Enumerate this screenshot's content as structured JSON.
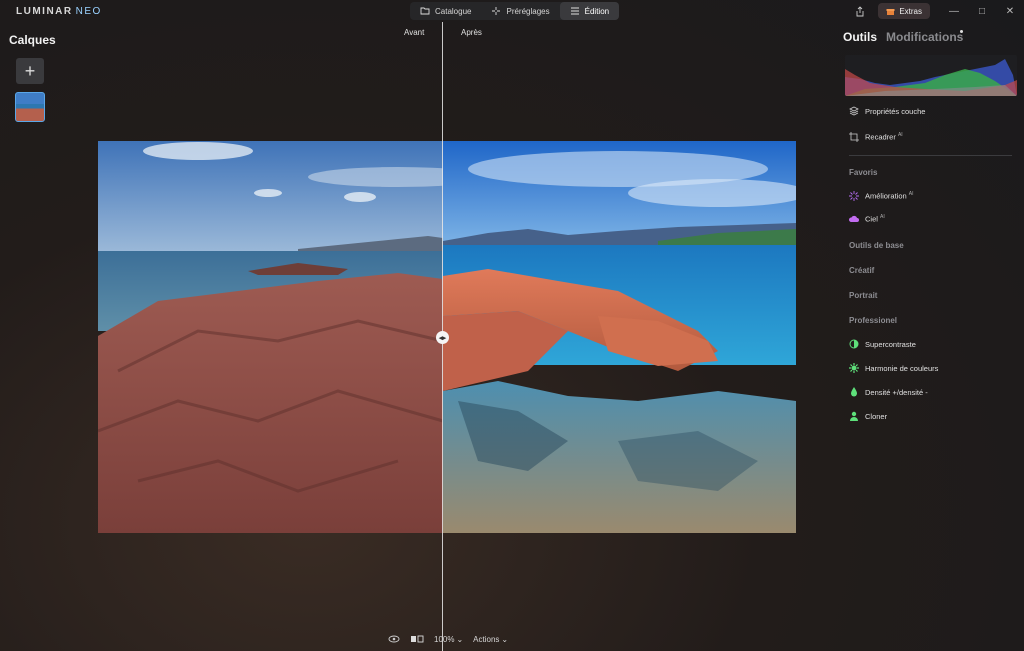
{
  "app": {
    "logo_main": "LUMINAR",
    "logo_sub": "NEO"
  },
  "modes": [
    {
      "label": "Catalogue",
      "icon": "folder-icon",
      "active": false
    },
    {
      "label": "Préréglages",
      "icon": "sparkle-icon",
      "active": false
    },
    {
      "label": "Édition",
      "icon": "sliders-icon",
      "active": true
    }
  ],
  "topright": {
    "extras_label": "Extras",
    "extras_color": "#e8823a"
  },
  "layers": {
    "title": "Calques",
    "add_label": "+"
  },
  "compare": {
    "before_label": "Avant",
    "after_label": "Après",
    "split_handle": "◂▸"
  },
  "bottom": {
    "zoom": "100%",
    "zoom_chevron": "⌄",
    "actions": "Actions",
    "actions_chevron": "⌄"
  },
  "right_panel": {
    "tabs": [
      {
        "label": "Outils",
        "active": true
      },
      {
        "label": "Modifications",
        "active": false
      }
    ],
    "top_tools": [
      {
        "label": "Propriétés couche",
        "icon": "layers-icon",
        "ai": ""
      },
      {
        "label": "Recadrer",
        "icon": "crop-icon",
        "ai": "AI"
      }
    ],
    "favorites_title": "Favoris",
    "favorites": [
      {
        "label": "Amélioration",
        "icon": "sparkle-icon",
        "ai": "AI",
        "color": "#b36cf0"
      },
      {
        "label": "Ciel",
        "icon": "cloud-icon",
        "ai": "AI",
        "color": "#c26cf0"
      }
    ],
    "sections": [
      "Outils de base",
      "Créatif",
      "Portrait",
      "Professionel"
    ],
    "pro_tools": [
      {
        "label": "Supercontraste",
        "icon": "contrast-icon",
        "color": "#5ee07a"
      },
      {
        "label": "Harmonie de couleurs",
        "icon": "gear-icon",
        "color": "#5ee07a"
      },
      {
        "label": "Densité +/densité -",
        "icon": "drop-icon",
        "color": "#5ee07a"
      },
      {
        "label": "Cloner",
        "icon": "person-icon",
        "color": "#5ee07a"
      }
    ]
  }
}
